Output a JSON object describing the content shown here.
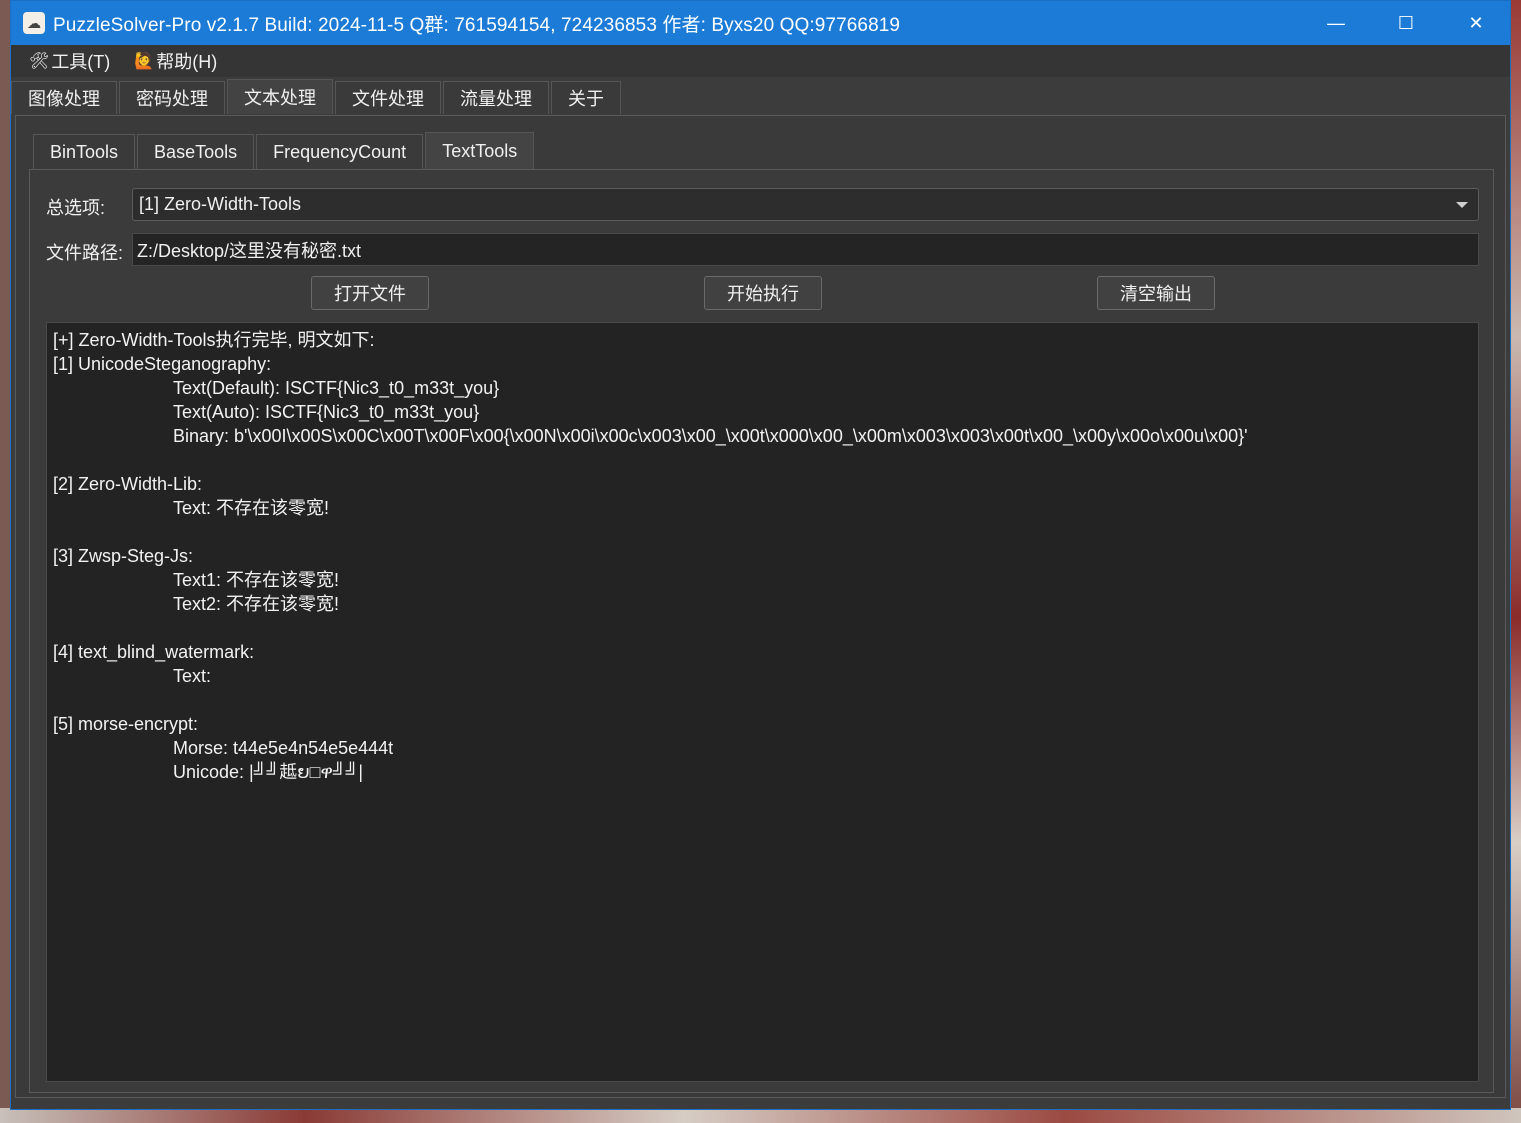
{
  "window": {
    "title": "PuzzleSolver-Pro v2.1.7  Build: 2024-11-5  Q群: 761594154, 724236853  作者: Byxs20  QQ:97766819",
    "minimize_glyph": "—",
    "maximize_glyph": "☐",
    "close_glyph": "✕"
  },
  "menubar": {
    "items": [
      {
        "label": "工具(T)",
        "icon": "tools-icon"
      },
      {
        "label": "帮助(H)",
        "icon": "help-person-icon"
      }
    ]
  },
  "main_tabs": [
    "图像处理",
    "密码处理",
    "文本处理",
    "文件处理",
    "流量处理",
    "关于"
  ],
  "main_tab_active": "文本处理",
  "sub_tabs": [
    "BinTools",
    "BaseTools",
    "FrequencyCount",
    "TextTools"
  ],
  "sub_tab_active": "TextTools",
  "form": {
    "option_label": "总选项:",
    "option_value": "[1] Zero-Width-Tools",
    "path_label": "文件路径:",
    "path_value": "Z:/Desktop/这里没有秘密.txt"
  },
  "buttons": {
    "open": "打开文件",
    "run": "开始执行",
    "clear": "清空输出"
  },
  "output": {
    "lines": [
      {
        "text": "[+] Zero-Width-Tools执行完毕, 明文如下:",
        "indent": false
      },
      {
        "text": "[1] UnicodeSteganography:",
        "indent": false
      },
      {
        "text": "Text(Default): ISCTF{Nic3_t0_m33t_you}",
        "indent": true
      },
      {
        "text": "Text(Auto): ISCTF{Nic3_t0_m33t_you}",
        "indent": true
      },
      {
        "text": "Binary: b'\\x00I\\x00S\\x00C\\x00T\\x00F\\x00{\\x00N\\x00i\\x00c\\x003\\x00_\\x00t\\x000\\x00_\\x00m\\x003\\x003\\x00t\\x00_\\x00y\\x00o\\x00u\\x00}'",
        "indent": true
      },
      {
        "text": "",
        "indent": false
      },
      {
        "text": "[2] Zero-Width-Lib:",
        "indent": false
      },
      {
        "text": "Text: 不存在该零宽!",
        "indent": true
      },
      {
        "text": "",
        "indent": false
      },
      {
        "text": "[3] Zwsp-Steg-Js:",
        "indent": false
      },
      {
        "text": "Text1: 不存在该零宽!",
        "indent": true
      },
      {
        "text": "Text2: 不存在该零宽!",
        "indent": true
      },
      {
        "text": "",
        "indent": false
      },
      {
        "text": "[4] text_blind_watermark:",
        "indent": false
      },
      {
        "text": "Text:",
        "indent": true
      },
      {
        "text": "",
        "indent": false
      },
      {
        "text": "[5] morse-encrypt:",
        "indent": false
      },
      {
        "text": "Morse: t44e5e4n54e5e444t",
        "indent": true
      },
      {
        "text": "Unicode: |╝╝趆ຍ□ዋ╝╝|",
        "indent": true
      }
    ]
  }
}
